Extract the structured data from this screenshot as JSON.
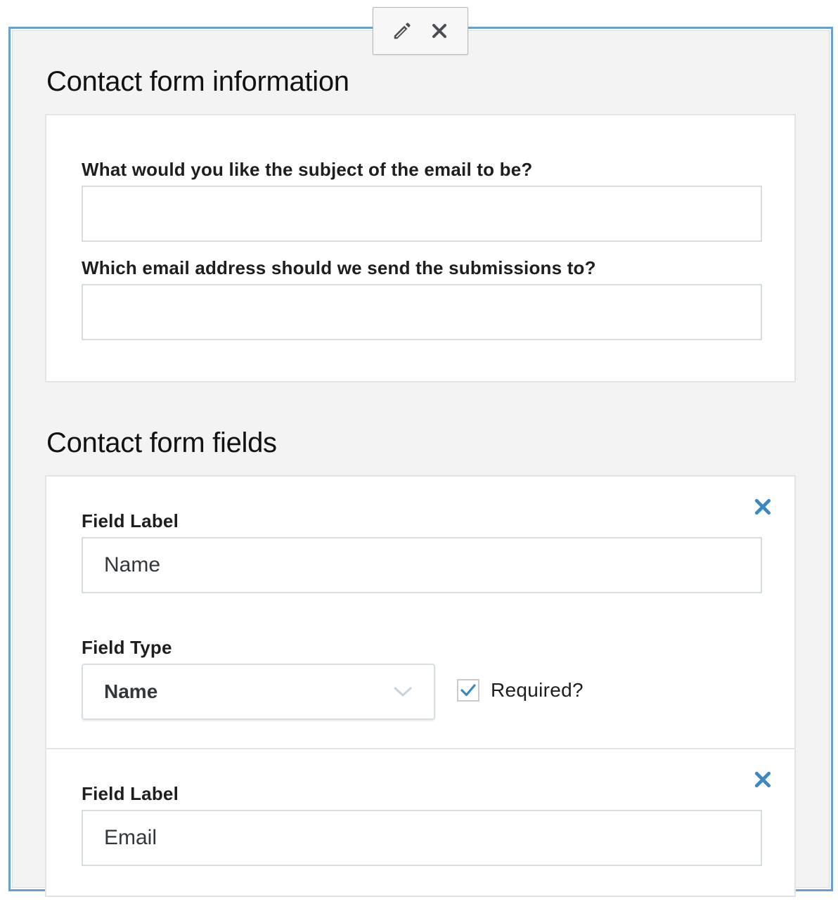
{
  "toolbar": {
    "edit_icon": "pencil-icon",
    "remove_icon": "close-icon"
  },
  "info_section": {
    "title": "Contact form information",
    "subject_label": "What would you like the subject of the email to be?",
    "subject_value": "",
    "recipient_label": "Which email address should we send the submissions to?",
    "recipient_value": ""
  },
  "fields_section": {
    "title": "Contact form fields",
    "fields": [
      {
        "label_caption": "Field Label",
        "label_value": "Name",
        "type_caption": "Field Type",
        "type_value": "Name",
        "required_label": "Required?",
        "required": true,
        "remove_icon": "close-icon"
      },
      {
        "label_caption": "Field Label",
        "label_value": "Email",
        "remove_icon": "close-icon"
      }
    ]
  },
  "colors": {
    "accent": "#3b88c3",
    "frame": "#6a9fd1",
    "background": "#f3f3f3"
  }
}
